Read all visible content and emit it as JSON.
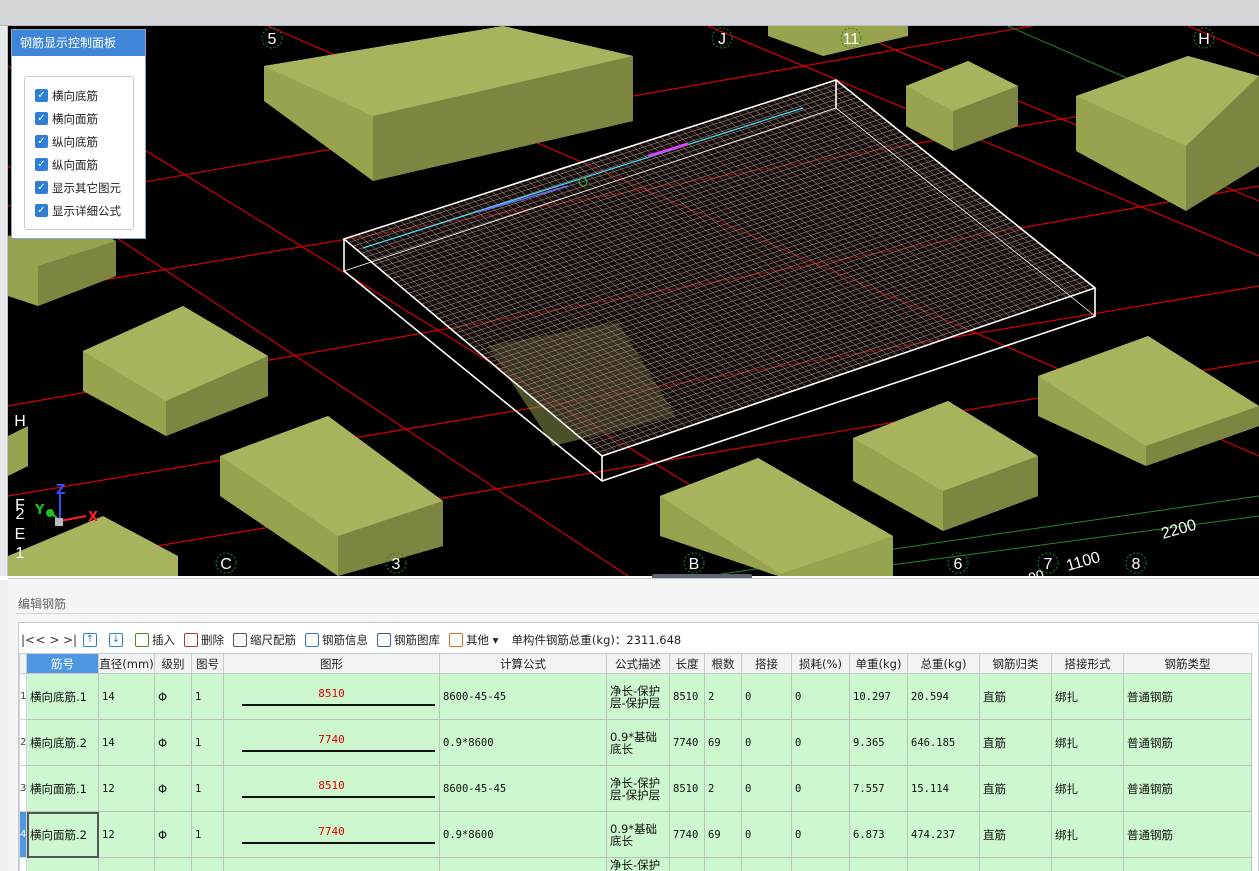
{
  "viewport": {
    "axis_labels": {
      "top": [
        "5",
        "J",
        "11",
        "H"
      ],
      "bottom": [
        "C",
        "3",
        "B",
        "6",
        "7",
        "8"
      ],
      "left": [
        "H",
        "F",
        "2",
        "E",
        "1"
      ]
    },
    "dimensions": [
      "1100",
      "2200",
      "00"
    ],
    "axes": {
      "x": "X",
      "y": "Y",
      "z": "Z"
    },
    "colors": {
      "column": "#8f9a4a",
      "grid_line": "#e00000",
      "green_line": "#1e8a2a",
      "background": "#000000"
    }
  },
  "control_panel": {
    "title": "钢筋显示控制面板",
    "options": [
      {
        "label": "横向底筋",
        "checked": true
      },
      {
        "label": "横向面筋",
        "checked": true
      },
      {
        "label": "纵向底筋",
        "checked": true
      },
      {
        "label": "纵向面筋",
        "checked": true
      },
      {
        "label": "显示其它图元",
        "checked": true
      },
      {
        "label": "显示详细公式",
        "checked": true
      }
    ]
  },
  "editor": {
    "title": "编辑钢筋",
    "toolbar": {
      "nav": [
        "|<",
        "<",
        ">",
        ">|"
      ],
      "items": [
        {
          "label": "插入",
          "icon": "insert-icon"
        },
        {
          "label": "删除",
          "icon": "delete-icon"
        },
        {
          "label": "缩尺配筋",
          "icon": "scale-rebar-icon"
        },
        {
          "label": "钢筋信息",
          "icon": "rebar-info-icon"
        },
        {
          "label": "钢筋图库",
          "icon": "rebar-library-icon"
        },
        {
          "label": "其他 ▾",
          "icon": "other-icon"
        }
      ],
      "total_weight": "单构件钢筋总重(kg)：2311.648"
    },
    "columns": [
      "筋号",
      "直径(mm)",
      "级别",
      "图号",
      "图形",
      "计算公式",
      "公式描述",
      "长度",
      "根数",
      "搭接",
      "损耗(%)",
      "单重(kg)",
      "总重(kg)",
      "钢筋归类",
      "搭接形式",
      "钢筋类型"
    ],
    "rows": [
      {
        "index": "1",
        "name": "横向底筋.1",
        "diameter": "14",
        "grade": "Φ",
        "figure_no": "1",
        "shape": "8510",
        "formula": "8600-45-45",
        "desc": "净长-保护层-保护层",
        "length": "8510",
        "count": "2",
        "lap": "0",
        "loss": "0",
        "unit_weight": "10.297",
        "total_weight": "20.594",
        "category": "直筋",
        "lap_type": "绑扎",
        "rebar_type": "普通钢筋"
      },
      {
        "index": "2",
        "name": "横向底筋.2",
        "diameter": "14",
        "grade": "Φ",
        "figure_no": "1",
        "shape": "7740",
        "formula": "0.9*8600",
        "desc": "0.9*基础底长",
        "length": "7740",
        "count": "69",
        "lap": "0",
        "loss": "0",
        "unit_weight": "9.365",
        "total_weight": "646.185",
        "category": "直筋",
        "lap_type": "绑扎",
        "rebar_type": "普通钢筋"
      },
      {
        "index": "3",
        "name": "横向面筋.1",
        "diameter": "12",
        "grade": "Φ",
        "figure_no": "1",
        "shape": "8510",
        "formula": "8600-45-45",
        "desc": "净长-保护层-保护层",
        "length": "8510",
        "count": "2",
        "lap": "0",
        "loss": "0",
        "unit_weight": "7.557",
        "total_weight": "15.114",
        "category": "直筋",
        "lap_type": "绑扎",
        "rebar_type": "普通钢筋"
      },
      {
        "index": "4",
        "name": "横向面筋.2",
        "diameter": "12",
        "grade": "Φ",
        "figure_no": "1",
        "shape": "7740",
        "formula": "0.9*8600",
        "desc": "0.9*基础底长",
        "length": "7740",
        "count": "69",
        "lap": "0",
        "loss": "0",
        "unit_weight": "6.873",
        "total_weight": "474.237",
        "category": "直筋",
        "lap_type": "绑扎",
        "rebar_type": "普通钢筋"
      }
    ],
    "partial_row_desc": "净长-保护"
  }
}
